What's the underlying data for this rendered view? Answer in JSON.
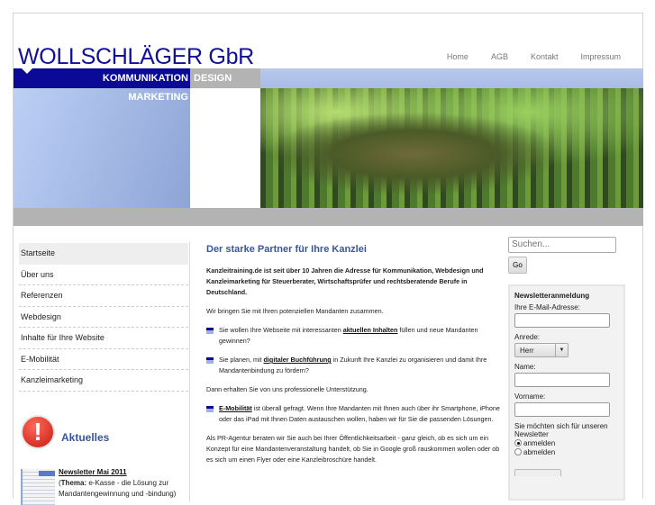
{
  "header": {
    "logo": "WOLLSCHLÄGER GbR",
    "nav": [
      "Home",
      "AGB",
      "Kontakt",
      "Impressum"
    ],
    "tagline": {
      "kommunikation": "KOMMUNIKATION",
      "design": "DESIGN",
      "marketing": "MARKETING"
    }
  },
  "sidebar": {
    "items": [
      "Startseite",
      "Über uns",
      "Referenzen",
      "Webdesign",
      "Inhalte für Ihre Website",
      "E-Mobilität",
      "Kanzleimarketing"
    ],
    "aktuelles": {
      "title": "Aktuelles",
      "news_link": "Newsletter Mai 2011",
      "thema_label": "Thema:",
      "thema_text": " e-Kasse - die Lösung zur Mandantengewinnung und -bindung)"
    }
  },
  "main": {
    "title": "Der starke Partner für Ihre Kanzlei",
    "intro": "Kanzleitraining.de ist seit über 10 Jahren die Adresse für Kommunikation, Webdesign und Kanzleimarketing für Steuerberater, Wirtschaftsprüfer und rechtsberatende Berufe in Deutschland.",
    "p1": "Wir bringen Sie mit Ihren potenziellen Mandanten zusammen.",
    "b1": {
      "pre": "Sie wollen Ihre Webseite mit interessanten ",
      "link": "aktuellen Inhalten",
      "post": " füllen und neue Mandanten gewinnen?"
    },
    "b2": {
      "pre": "Sie planen, mit ",
      "link": "digitaler Buchführung",
      "post": " in Zukunft Ihre Kanzlei zu organisieren und damit Ihre Mandantenbindung zu fördern?"
    },
    "p2": "Dann erhalten Sie von uns professionelle Unterstützung.",
    "b3": {
      "link": "E-Mobilität",
      "post": " ist überall gefragt. Wenn Ihre Mandanten mit Ihnen auch über ihr Smartphone, iPhone oder das iPad mit Ihnen Daten austauschen wollen, haben wir für Sie die passenden Lösungen."
    },
    "p3": "Als PR-Agentur beraten wir Sie auch bei Ihrer Öffentlichkeitsarbeit - ganz gleich, ob es sich um ein Konzept für eine Mandantenveranstaltung handelt, ob Sie in Google groß rauskommen wollen oder ob es sich um einen Flyer oder eine Kanzleibroschüre handelt."
  },
  "right": {
    "search_placeholder": "Suchen...",
    "go": "Go",
    "newsletter": {
      "title": "Newsletteranmeldung",
      "email_label": "Ihre E-Mail-Adresse:",
      "anrede_label": "Anrede:",
      "anrede_value": "Herr",
      "name_label": "Name:",
      "vorname_label": "Vorname:",
      "question": "Sie möchten sich für unseren Newsletter",
      "opt1": "anmelden",
      "opt2": "abmelden"
    }
  }
}
